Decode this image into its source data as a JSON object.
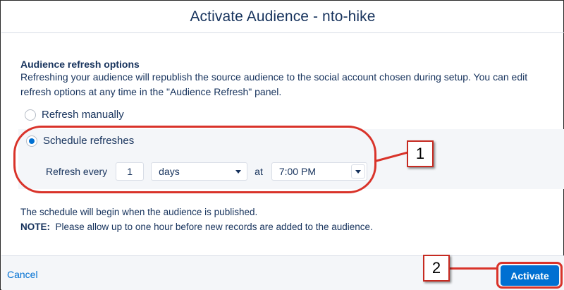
{
  "modal": {
    "title": "Activate Audience - nto-hike"
  },
  "options": {
    "section_title": "Audience refresh options",
    "description": "Refreshing your audience will republish the source audience to the social account chosen during setup. You can edit refresh options at any time in the \"Audience Refresh\" panel.",
    "radio_manual_label": "Refresh manually",
    "radio_schedule_label": "Schedule refreshes",
    "selected": "schedule"
  },
  "schedule": {
    "refresh_every_label": "Refresh every",
    "interval_value": "1",
    "unit_value": "days",
    "at_label": "at",
    "time_value": "7:00 PM"
  },
  "notes": {
    "schedule_begin": "The schedule will begin when the audience is published.",
    "note_label": "NOTE:",
    "note_text": "Please allow up to one hour before new records are added to the audience."
  },
  "footer": {
    "cancel_label": "Cancel",
    "activate_label": "Activate"
  },
  "annotations": {
    "callout_1": "1",
    "callout_2": "2"
  },
  "colors": {
    "accent": "#0070d2",
    "annotation": "#d9332a",
    "text": "#16325c"
  }
}
